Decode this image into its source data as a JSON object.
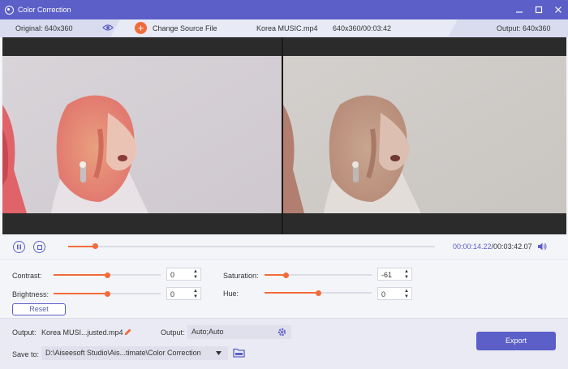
{
  "window": {
    "title": "Color Correction"
  },
  "infobar": {
    "original": "Original: 640x360",
    "change_source": "Change Source File",
    "file_name": "Korea MUSIC.mp4",
    "file_meta": "640x360/00:03:42",
    "output": "Output: 640x360"
  },
  "player": {
    "current_time": "00:00:14.22",
    "total_time": "/00:03:42.07",
    "progress_fraction": 0.072
  },
  "adjust": {
    "contrast": {
      "label": "Contrast:",
      "value": "0",
      "fraction": 0.5
    },
    "brightness": {
      "label": "Brightness:",
      "value": "0",
      "fraction": 0.5
    },
    "saturation": {
      "label": "Saturation:",
      "value": "-61",
      "fraction": 0.2
    },
    "hue": {
      "label": "Hue:",
      "value": "0",
      "fraction": 0.5
    },
    "reset_label": "Reset"
  },
  "bottom": {
    "output_label": "Output:",
    "output_file": "Korea MUSI...justed.mp4",
    "output_format_label": "Output:",
    "output_format": "Auto;Auto",
    "save_to_label": "Save to:",
    "save_path": "D:\\Aiseesoft Studio\\Ais...timate\\Color Correction",
    "export_label": "Export"
  },
  "colors": {
    "accent": "#5b5fc7",
    "orange": "#f26b3a"
  }
}
